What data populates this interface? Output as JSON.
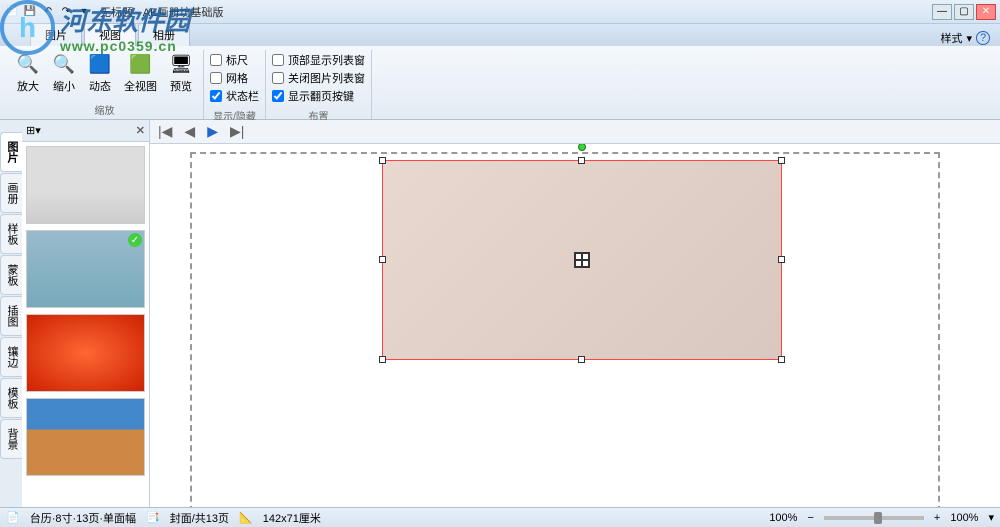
{
  "titlebar": {
    "title": "无标题 - AE画册坊基础版"
  },
  "tabs": {
    "t1": "图片",
    "t2": "视图",
    "t3": "相册",
    "style_label": "样式",
    "help_icon": "help-icon"
  },
  "ribbon": {
    "zoom_in": "放大",
    "zoom_out": "缩小",
    "dynamic": "动态",
    "full_view": "全视图",
    "preview": "预览",
    "group_zoom": "缩放",
    "group_showhide": "显示/隐藏",
    "group_layout": "布置",
    "ruler": "标尺",
    "grid": "网格",
    "statusbar_label": "状态栏",
    "top_list": "顶部显示列表窗",
    "close_list": "关闭图片列表窗",
    "show_nav": "显示翻页按键"
  },
  "side_tabs": {
    "t0": "图片",
    "t1": "画册",
    "t2": "样板",
    "t3": "蒙板",
    "t4": "插图",
    "t5": "镶边",
    "t6": "模板",
    "t7": "背景"
  },
  "thumb_header": {
    "icon1": "⊞",
    "icon2": "▾",
    "close": "✕"
  },
  "status": {
    "doc": "台历·8寸·13页·单面幅",
    "page": "封面/共13页",
    "size": "142x71厘米",
    "zoom": "100%",
    "zoom2": "100%"
  },
  "watermark": {
    "logo": "h",
    "text1": "河东软件园",
    "text2": "www.pc0359.cn"
  },
  "playback": {
    "first": "|◀",
    "prev": "◀",
    "play": "▶",
    "next": "▶|"
  }
}
